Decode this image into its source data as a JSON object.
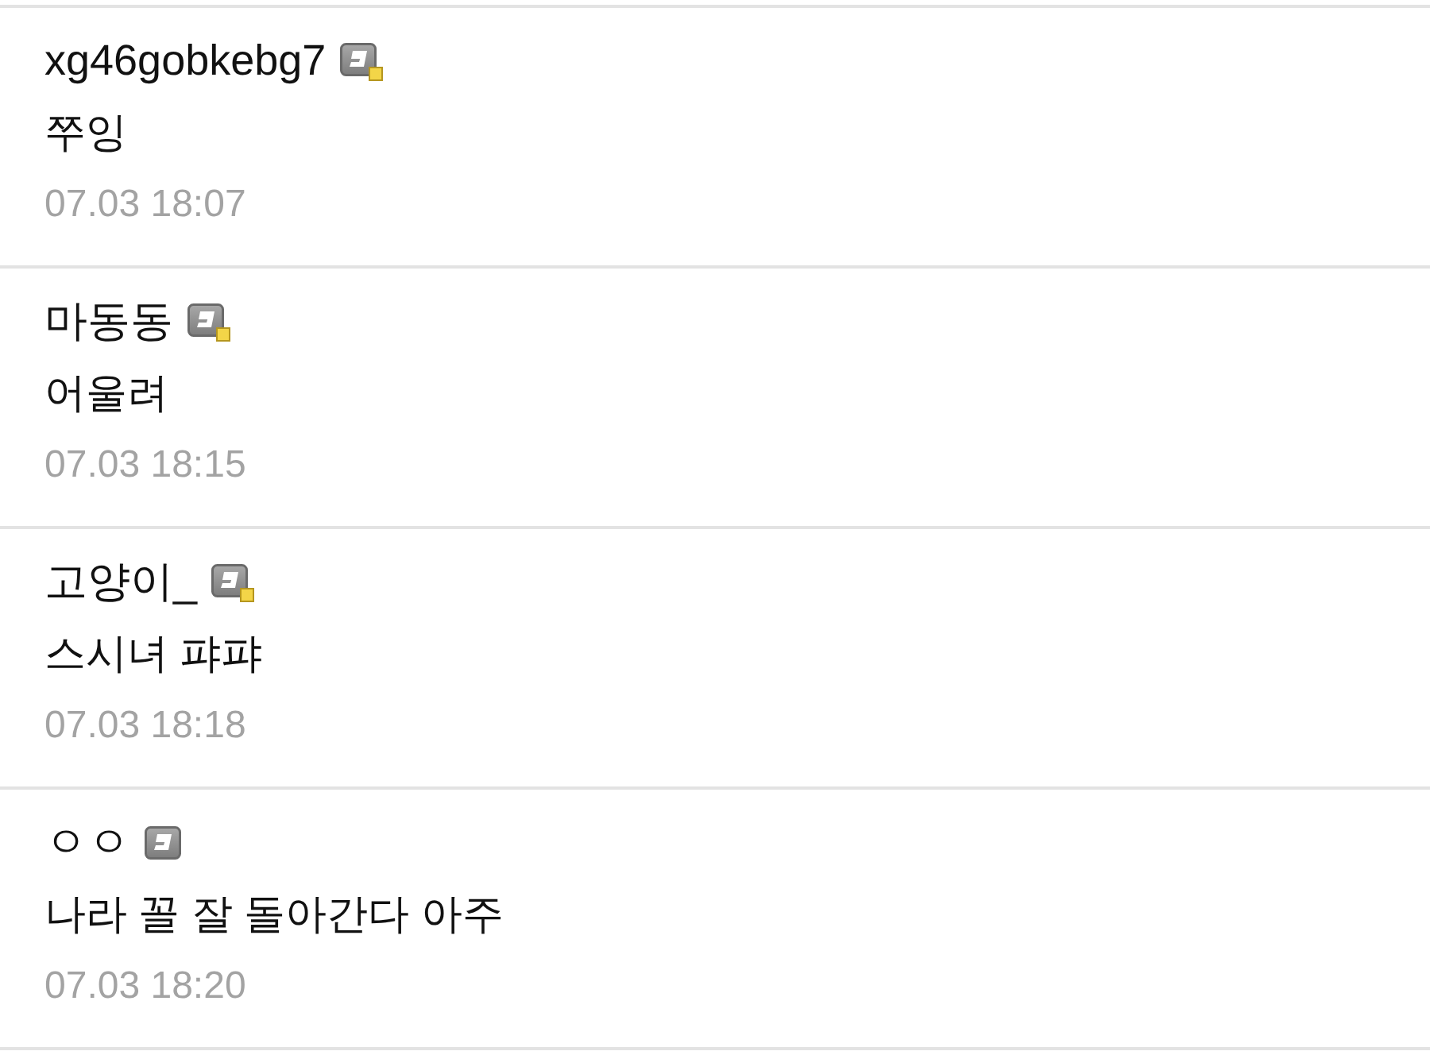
{
  "comments": [
    {
      "author": "xg46gobkebg7",
      "badge_dot": true,
      "text": "쭈잉",
      "time": "07.03 18:07"
    },
    {
      "author": "마동동",
      "badge_dot": true,
      "text": "어울려",
      "time": "07.03 18:15"
    },
    {
      "author": "고양이_",
      "badge_dot": true,
      "text": "스시녀 퍄퍄",
      "time": "07.03 18:18"
    },
    {
      "author": "ㅇㅇ",
      "badge_dot": false,
      "text": "나라 꼴 잘 돌아간다 아주",
      "time": "07.03 18:20"
    }
  ]
}
